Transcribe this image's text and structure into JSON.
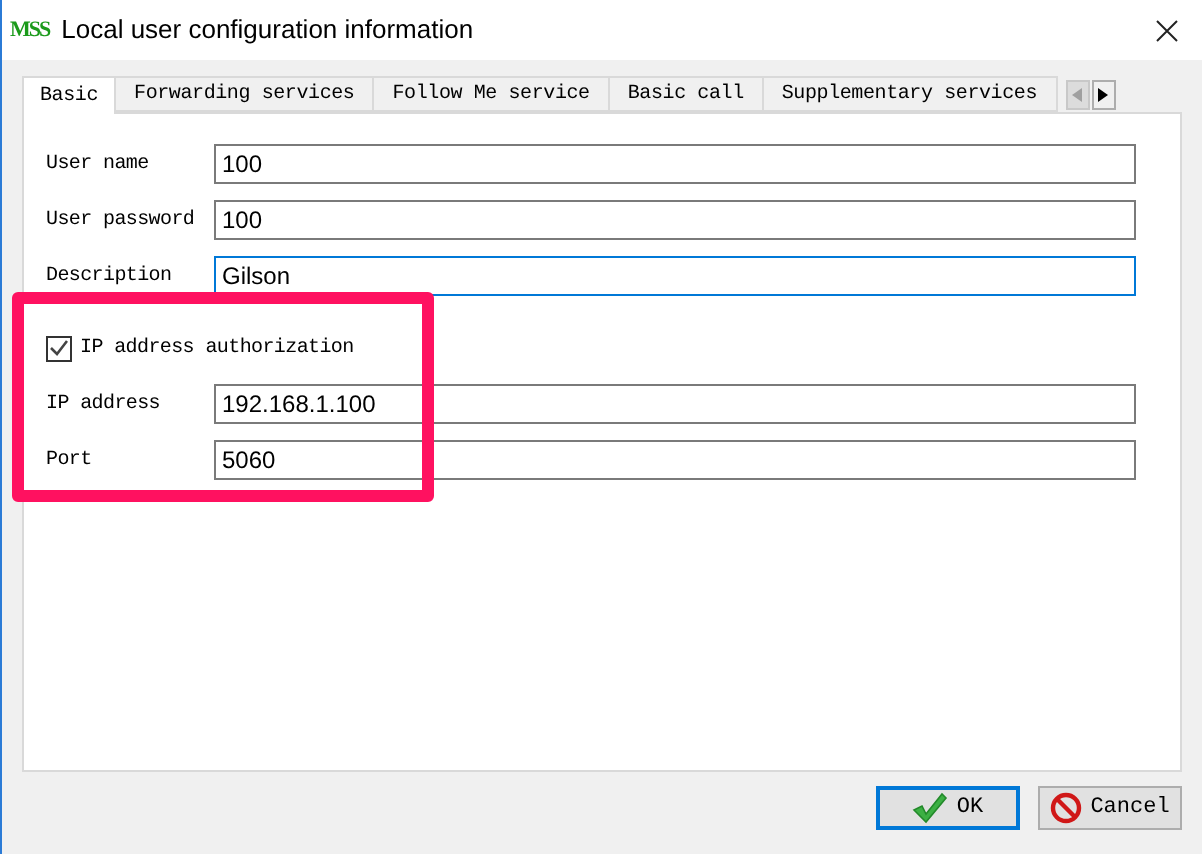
{
  "window": {
    "title": "Local user configuration information",
    "logo": "MSS"
  },
  "tabs": [
    {
      "label": "Basic",
      "selected": true
    },
    {
      "label": "Forwarding services",
      "selected": false
    },
    {
      "label": "Follow Me service",
      "selected": false
    },
    {
      "label": "Basic call",
      "selected": false
    },
    {
      "label": "Supplementary services",
      "selected": false
    }
  ],
  "fields": [
    {
      "kind": "text",
      "label": "User name",
      "value": "100",
      "focused": false
    },
    {
      "kind": "text",
      "label": "User password",
      "value": "100",
      "focused": false
    },
    {
      "kind": "text",
      "label": "Description",
      "value": "Gilson",
      "focused": true
    },
    {
      "kind": "checkbox",
      "label": "IP address authorization",
      "checked": true
    },
    {
      "kind": "text",
      "label": "IP address",
      "value": "192.168.1.100",
      "focused": false
    },
    {
      "kind": "text",
      "label": "Port",
      "value": "5060",
      "focused": false
    }
  ],
  "buttons": [
    {
      "kind": "ok",
      "label": "OK",
      "selected": true
    },
    {
      "kind": "cancel",
      "label": "Cancel",
      "selected": false
    }
  ]
}
